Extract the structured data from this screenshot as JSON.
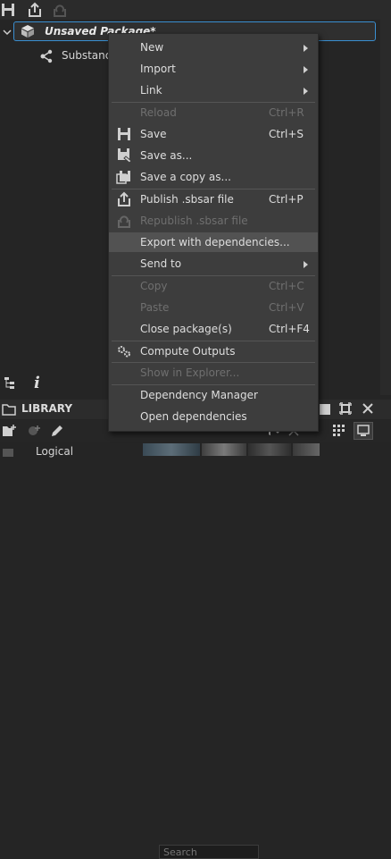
{
  "explorer": {
    "package_name": "Unsaved Package*",
    "child_label": "Substance"
  },
  "library": {
    "title": "LIBRARY",
    "search_placeholder": "Search",
    "logical_label": "Logical"
  },
  "bottom_tools": {
    "info_glyph": "i"
  },
  "context_menu": {
    "new": {
      "label": "New"
    },
    "import": {
      "label": "Import"
    },
    "link": {
      "label": "Link"
    },
    "reload": {
      "label": "Reload",
      "shortcut": "Ctrl+R"
    },
    "save": {
      "label": "Save",
      "shortcut": "Ctrl+S"
    },
    "save_as": {
      "label": "Save as..."
    },
    "save_copy": {
      "label": "Save a copy as..."
    },
    "publish": {
      "label": "Publish .sbsar file",
      "shortcut": "Ctrl+P"
    },
    "republish": {
      "label": "Republish .sbsar file"
    },
    "export_deps": {
      "label": "Export with dependencies..."
    },
    "send_to": {
      "label": "Send to"
    },
    "copy": {
      "label": "Copy",
      "shortcut": "Ctrl+C"
    },
    "paste": {
      "label": "Paste",
      "shortcut": "Ctrl+V"
    },
    "close_pkg": {
      "label": "Close package(s)",
      "shortcut": "Ctrl+F4"
    },
    "compute": {
      "label": "Compute Outputs"
    },
    "show_explorer": {
      "label": "Show in Explorer..."
    },
    "dep_manager": {
      "label": "Dependency Manager"
    },
    "open_deps": {
      "label": "Open dependencies"
    }
  },
  "colors": {
    "accent_border": "#3a8fd1",
    "menu_bg": "#3d3d3d",
    "highlight": "#525252"
  }
}
